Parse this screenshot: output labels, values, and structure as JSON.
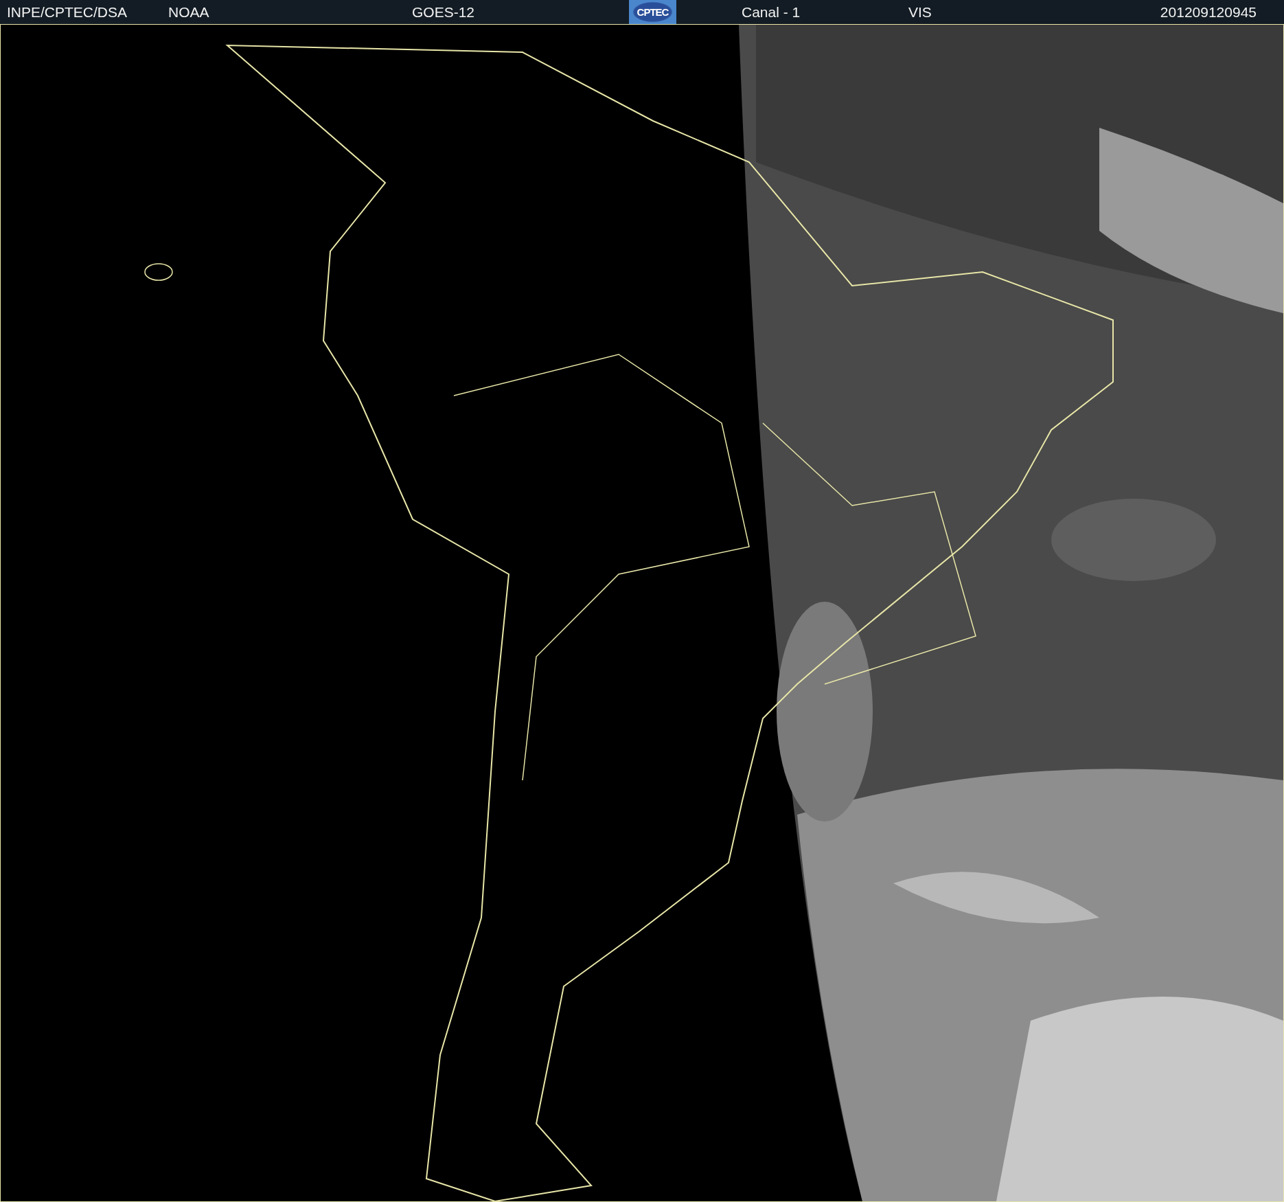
{
  "header": {
    "source": "INPE/CPTEC/DSA",
    "agency": "NOAA",
    "satellite": "GOES-12",
    "logo": "CPTEC",
    "channel": "Canal - 1",
    "band": "VIS",
    "timestamp": "201209120945"
  }
}
